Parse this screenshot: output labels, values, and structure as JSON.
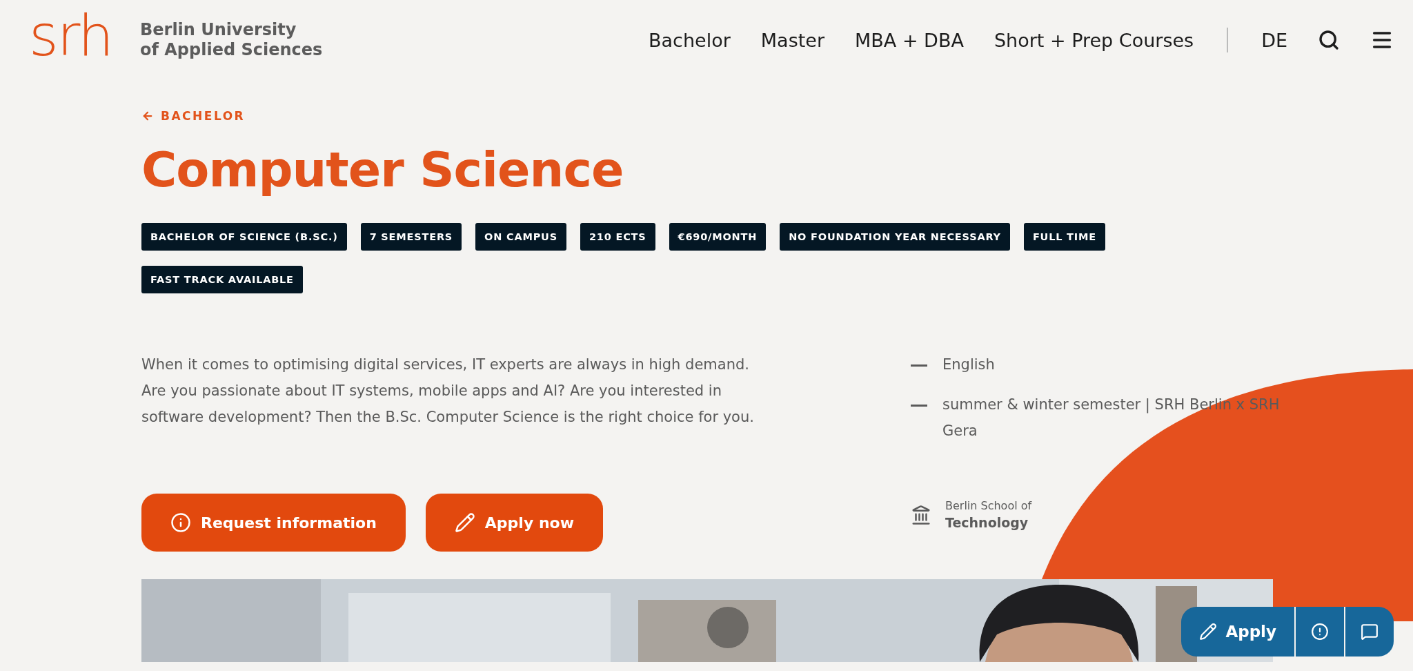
{
  "header": {
    "logo_mark": "srh",
    "logo_text": [
      "Berlin University",
      "of Applied Sciences"
    ],
    "nav": [
      "Bachelor",
      "Master",
      "MBA + DBA",
      "Short + Prep Courses"
    ],
    "language": "DE"
  },
  "back_link": "BACHELOR",
  "title": "Computer Science",
  "tags": [
    "BACHELOR OF SCIENCE (B.SC.)",
    "7 SEMESTERS",
    "ON CAMPUS",
    "210 ECTS",
    "€690/MONTH",
    "NO FOUNDATION YEAR NECESSARY",
    "FULL TIME",
    "FAST TRACK AVAILABLE"
  ],
  "description": "When it comes to optimising digital services, IT experts are always in high demand. Are you passionate about IT systems, mobile apps and AI? Are you interested in software development? Then the B.Sc. Computer Science is the right choice for you.",
  "facts": [
    "English",
    "summer & winter semester | SRH Berlin x SRH Gera"
  ],
  "school": {
    "line1": "Berlin School of",
    "line2": "Technology"
  },
  "buttons": [
    {
      "kind": "info",
      "label": "Request information"
    },
    {
      "kind": "pencil",
      "label": "Apply now"
    }
  ],
  "floating_bar": {
    "apply_label": "Apply"
  }
}
